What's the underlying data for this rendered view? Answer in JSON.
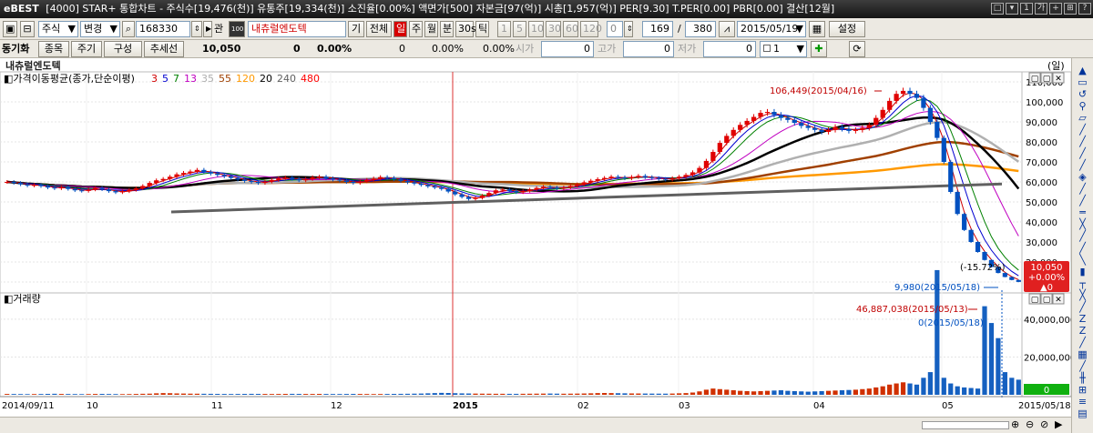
{
  "title_bar": {
    "logo": "eBEST",
    "text": "[4000] STAR+ 통합차트 - 주식수[19,476(천)] 유통주[19,334(천)] 소진율[0.00%] 액면가[500] 자본금[97(억)] 시총[1,957(억)] PER[9.30] T.PER[0.00] PBR[0.00] 결산[12월]",
    "window_buttons": [
      "□",
      "▾",
      "1",
      "가",
      "+",
      "⊞",
      "?"
    ]
  },
  "toolbar1": {
    "market_select": "주식",
    "change_select": "변경",
    "code": "168330",
    "rel_btn": "관",
    "stock_name": "내츄럴엔도텍",
    "btn_gi": "기",
    "btn_all": "전체",
    "periods": [
      "일",
      "주",
      "월",
      "분",
      "30s",
      "틱"
    ],
    "minutes": [
      "1",
      "5",
      "10",
      "30",
      "60",
      "120"
    ],
    "count1": "0",
    "count2": "169",
    "slash": "/",
    "count3": "380",
    "date": "2015/05/19",
    "settings": "설정"
  },
  "toolbar2": {
    "sync_label": "동기화",
    "btn_stock": "종목",
    "btn_period": "주기",
    "btn_config": "구성",
    "btn_trend": "추세선",
    "price": "10,050",
    "change": "0",
    "rate": "0.00%",
    "f1": "0",
    "f2": "0.00%",
    "f3": "0.00%",
    "open_label": "시가",
    "open_val": "0",
    "high_label": "고가",
    "high_val": "0",
    "low_label": "저가",
    "low_val": "0",
    "count_sel": "1"
  },
  "chart_header": {
    "name": "내츄럴엔도텍",
    "unit": "(일)"
  },
  "price_panel": {
    "ma_label": "가격이동평균(종가,단순이평)",
    "ma_periods": [
      {
        "p": "3",
        "color": "#d00000"
      },
      {
        "p": "5",
        "color": "#0000d0"
      },
      {
        "p": "7",
        "color": "#008000"
      },
      {
        "p": "13",
        "color": "#c000c0"
      },
      {
        "p": "35",
        "color": "#b0b0b0"
      },
      {
        "p": "55",
        "color": "#a04000"
      },
      {
        "p": "120",
        "color": "#ff9900"
      },
      {
        "p": "20",
        "color": "#000000"
      },
      {
        "p": "240",
        "color": "#606060"
      },
      {
        "p": "480",
        "color": "#ff0000"
      }
    ],
    "high_annot": "106,449(2015/04/16)",
    "low_annot": "9,980(2015/05/18)",
    "pct_annot": "(-15.72%)",
    "current_box": [
      "10,050",
      "+0.00%",
      "▲0"
    ],
    "y_ticks": [
      "110,000",
      "100,000",
      "90,000",
      "80,000",
      "70,000",
      "60,000",
      "50,000",
      "40,000",
      "30,000",
      "20,000",
      "10,000"
    ]
  },
  "volume_panel": {
    "label": "거래량",
    "high_annot": "46,887,038(2015/05/13)",
    "low_annot": "0(2015/05/18)",
    "y_ticks": [
      "40,000,000",
      "20,000,000"
    ],
    "current_box": "0"
  },
  "x_axis": [
    "2014/09/11",
    "10",
    "11",
    "12",
    "2015",
    "02",
    "03",
    "04",
    "05",
    "2015/05/18"
  ],
  "chart_data": {
    "type": "candlestick",
    "price_ylim": [
      5000,
      115000
    ],
    "volume_ylim": [
      0,
      52000000
    ],
    "close": [
      60000,
      59500,
      58800,
      58200,
      58500,
      57900,
      57200,
      56800,
      57500,
      56500,
      55800,
      55500,
      56200,
      57000,
      56300,
      55400,
      54800,
      55300,
      56000,
      56800,
      58000,
      59500,
      60800,
      61500,
      62600,
      63800,
      64500,
      65200,
      66000,
      65000,
      64200,
      63500,
      62800,
      62000,
      61200,
      60500,
      60000,
      59500,
      60200,
      61000,
      61800,
      62200,
      61500,
      60800,
      61500,
      62300,
      62600,
      61800,
      61200,
      60700,
      60000,
      59500,
      60300,
      61000,
      61700,
      62400,
      62000,
      61300,
      60500,
      59800,
      59200,
      58500,
      57800,
      57200,
      56500,
      55200,
      53800,
      52500,
      51500,
      52000,
      53200,
      54500,
      55800,
      56200,
      55500,
      54800,
      55500,
      56200,
      57000,
      57600,
      57200,
      56700,
      57300,
      58000,
      58800,
      59800,
      60600,
      61400,
      62000,
      62600,
      62300,
      61800,
      62500,
      63000,
      62400,
      61900,
      61500,
      61200,
      61900,
      62600,
      63500,
      64800,
      67000,
      70500,
      75000,
      79500,
      83000,
      86000,
      88500,
      90500,
      92500,
      94500,
      95000,
      93500,
      92000,
      91000,
      89500,
      88000,
      87000,
      86000,
      85000,
      86000,
      87500,
      86500,
      85500,
      86000,
      87000,
      88500,
      92000,
      96000,
      100500,
      104000,
      105500,
      104000,
      102000,
      97000,
      90000,
      82000,
      70000,
      55000,
      44000,
      36000,
      30000,
      25000,
      21000,
      17500,
      14500,
      12500,
      11000,
      10050
    ],
    "volume": [
      150,
      140,
      130,
      120,
      130,
      140,
      160,
      180,
      150,
      140,
      130,
      120,
      130,
      150,
      160,
      140,
      130,
      120,
      130,
      150,
      180,
      200,
      260,
      300,
      280,
      240,
      220,
      200,
      190,
      180,
      170,
      160,
      150,
      140,
      150,
      160,
      170,
      160,
      150,
      140,
      150,
      160,
      170,
      160,
      150,
      150,
      160,
      150,
      140,
      140,
      150,
      160,
      150,
      140,
      130,
      140,
      150,
      160,
      170,
      180,
      200,
      220,
      260,
      300,
      340,
      320,
      280,
      250,
      230,
      210,
      200,
      190,
      180,
      180,
      170,
      170,
      180,
      190,
      200,
      210,
      220,
      200,
      190,
      200,
      210,
      230,
      260,
      300,
      320,
      300,
      280,
      260,
      240,
      230,
      220,
      210,
      200,
      200,
      220,
      260,
      300,
      400,
      600,
      900,
      1100,
      1000,
      900,
      800,
      700,
      650,
      600,
      650,
      700,
      750,
      800,
      700,
      650,
      600,
      550,
      600,
      650,
      700,
      750,
      800,
      850,
      900,
      1000,
      1100,
      1300,
      1500,
      1800,
      2000,
      2200,
      2000,
      1800,
      3000,
      4000,
      22000,
      3000,
      2000,
      1500,
      1300,
      1200,
      1100,
      46887038,
      38000000,
      30000000,
      12000000,
      9000000,
      8000000
    ]
  }
}
